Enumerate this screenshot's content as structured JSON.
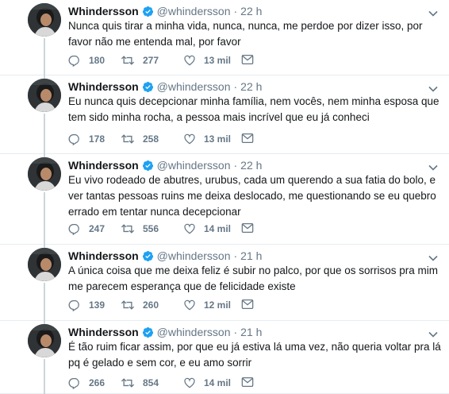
{
  "tweets": [
    {
      "name": "Whindersson",
      "handle": "@whindersson",
      "dot": "·",
      "time": "22 h",
      "text": "Nunca quis tirar a minha vida, nunca, nunca, me perdoe por dizer isso, por favor não me entenda mal, por favor",
      "replies": "180",
      "retweets": "277",
      "likes": "13 mil"
    },
    {
      "name": "Whindersson",
      "handle": "@whindersson",
      "dot": "·",
      "time": "22 h",
      "text": "Eu nunca quis decepcionar minha família, nem vocês, nem minha esposa que tem sido minha rocha, a pessoa mais incrível que eu já conheci",
      "replies": "178",
      "retweets": "258",
      "likes": "13 mil"
    },
    {
      "name": "Whindersson",
      "handle": "@whindersson",
      "dot": "·",
      "time": "22 h",
      "text": "Eu vivo rodeado de abutres, urubus, cada um querendo a sua fatia do bolo, e ver tantas pessoas ruins me deixa deslocado, me questionando se eu quebro errado em tentar nunca decepcionar",
      "replies": "247",
      "retweets": "556",
      "likes": "14 mil"
    },
    {
      "name": "Whindersson",
      "handle": "@whindersson",
      "dot": "·",
      "time": "21 h",
      "text": "A única coisa que me deixa feliz é subir no palco, por que os sorrisos pra mim me parecem esperança que de felicidade existe",
      "replies": "139",
      "retweets": "260",
      "likes": "12 mil"
    },
    {
      "name": "Whindersson",
      "handle": "@whindersson",
      "dot": "·",
      "time": "21 h",
      "text": "É tão ruim ficar assim, por que eu já estiva lá uma vez, não queria voltar pra lá pq é gelado e sem cor, e eu amo sorrir",
      "replies": "266",
      "retweets": "854",
      "likes": "14 mil"
    }
  ],
  "colors": {
    "text": "#14171a",
    "secondary": "#657786",
    "verified": "#1da1f2",
    "retweet_active": "#17bf63",
    "thread_line": "#cbd6dd",
    "divider": "#e6ecf0"
  },
  "icons": {
    "verified": "verified-badge-icon",
    "caret": "chevron-down-icon",
    "reply": "reply-icon",
    "retweet": "retweet-icon",
    "like": "heart-icon",
    "dm": "envelope-icon"
  }
}
